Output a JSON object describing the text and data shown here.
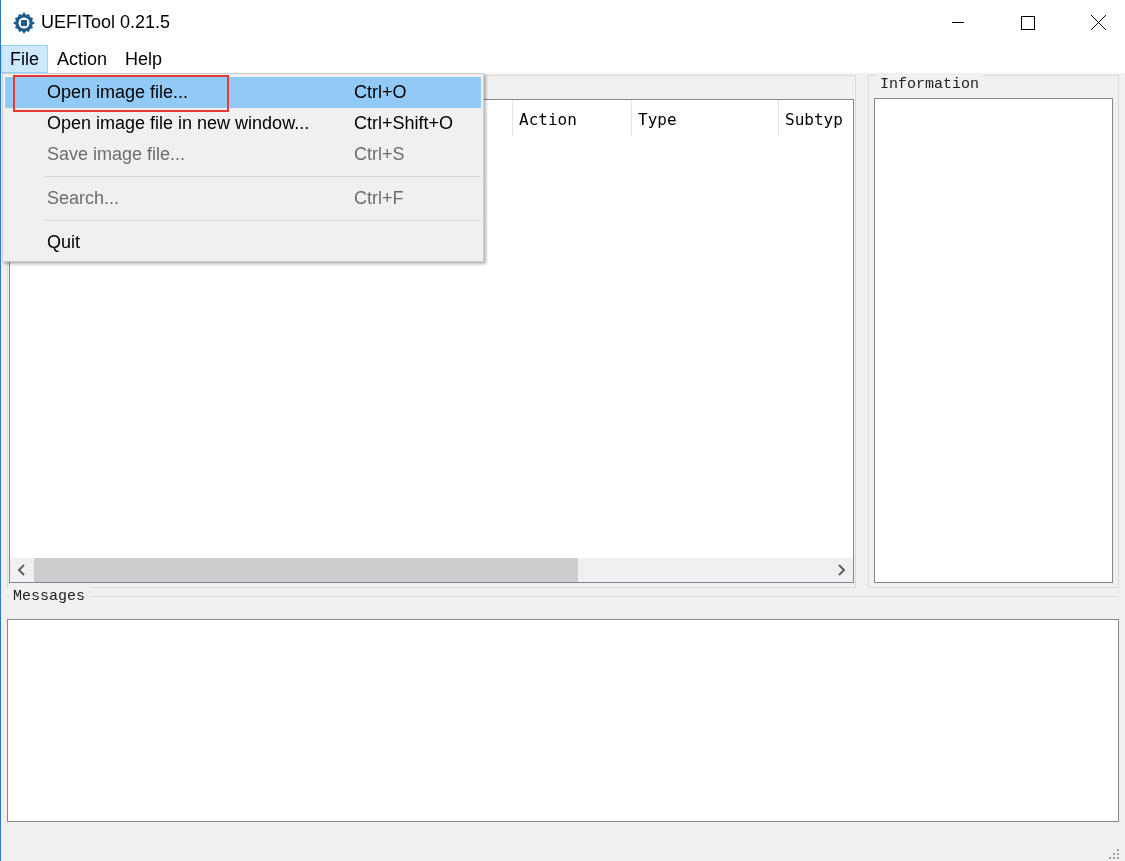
{
  "window": {
    "title": "UEFITool 0.21.5"
  },
  "menubar": [
    {
      "label": "File",
      "selected": true
    },
    {
      "label": "Action",
      "selected": false
    },
    {
      "label": "Help",
      "selected": false
    }
  ],
  "menu": [
    {
      "kind": "item",
      "label": "Open image file...",
      "shortcut": "Ctrl+O",
      "selected": true,
      "disabled": false,
      "annotated": true
    },
    {
      "kind": "item",
      "label": "Open image file in new window...",
      "shortcut": "Ctrl+Shift+O",
      "selected": false,
      "disabled": false,
      "annotated": false
    },
    {
      "kind": "item",
      "label": "Save image file...",
      "shortcut": "Ctrl+S",
      "selected": false,
      "disabled": true,
      "annotated": false
    },
    {
      "kind": "separator"
    },
    {
      "kind": "item",
      "label": "Search...",
      "shortcut": "Ctrl+F",
      "selected": false,
      "disabled": true,
      "annotated": false
    },
    {
      "kind": "separator"
    },
    {
      "kind": "item",
      "label": "Quit",
      "selected": false,
      "disabled": false,
      "annotated": false
    }
  ],
  "structure": {
    "columns": [
      "Action",
      "Type",
      "Subtyp"
    ]
  },
  "information": {
    "title": "Information"
  },
  "messages": {
    "title": "Messages"
  }
}
